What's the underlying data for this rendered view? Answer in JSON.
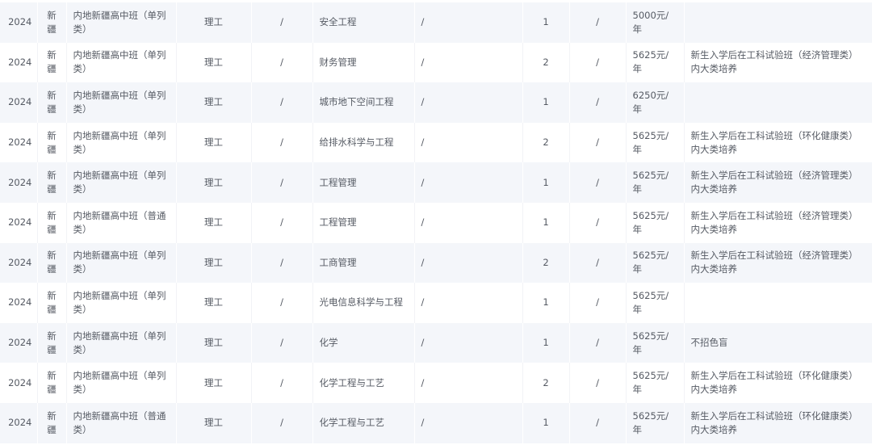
{
  "table": {
    "rows": [
      {
        "year": "2024",
        "region": "新疆",
        "batch": "内地新疆高中班（单列类）",
        "subject": "理工",
        "x1": "/",
        "major": "安全工程",
        "x2": "/",
        "count": "1",
        "x3": "/",
        "fee": "5000元/年",
        "note": ""
      },
      {
        "year": "2024",
        "region": "新疆",
        "batch": "内地新疆高中班（单列类）",
        "subject": "理工",
        "x1": "/",
        "major": "财务管理",
        "x2": "/",
        "count": "2",
        "x3": "/",
        "fee": "5625元/年",
        "note": "新生入学后在工科试验班（经济管理类）内大类培养"
      },
      {
        "year": "2024",
        "region": "新疆",
        "batch": "内地新疆高中班（单列类）",
        "subject": "理工",
        "x1": "/",
        "major": "城市地下空间工程",
        "x2": "/",
        "count": "1",
        "x3": "/",
        "fee": "6250元/年",
        "note": ""
      },
      {
        "year": "2024",
        "region": "新疆",
        "batch": "内地新疆高中班（单列类）",
        "subject": "理工",
        "x1": "/",
        "major": "给排水科学与工程",
        "x2": "/",
        "count": "2",
        "x3": "/",
        "fee": "5625元/年",
        "note": "新生入学后在工科试验班（环化健康类）内大类培养"
      },
      {
        "year": "2024",
        "region": "新疆",
        "batch": "内地新疆高中班（单列类）",
        "subject": "理工",
        "x1": "/",
        "major": "工程管理",
        "x2": "/",
        "count": "1",
        "x3": "/",
        "fee": "5625元/年",
        "note": "新生入学后在工科试验班（经济管理类）内大类培养"
      },
      {
        "year": "2024",
        "region": "新疆",
        "batch": "内地新疆高中班（普通类）",
        "subject": "理工",
        "x1": "/",
        "major": "工程管理",
        "x2": "/",
        "count": "1",
        "x3": "/",
        "fee": "5625元/年",
        "note": "新生入学后在工科试验班（经济管理类）内大类培养"
      },
      {
        "year": "2024",
        "region": "新疆",
        "batch": "内地新疆高中班（单列类）",
        "subject": "理工",
        "x1": "/",
        "major": "工商管理",
        "x2": "/",
        "count": "2",
        "x3": "/",
        "fee": "5625元/年",
        "note": "新生入学后在工科试验班（经济管理类）内大类培养"
      },
      {
        "year": "2024",
        "region": "新疆",
        "batch": "内地新疆高中班（单列类）",
        "subject": "理工",
        "x1": "/",
        "major": "光电信息科学与工程",
        "x2": "/",
        "count": "1",
        "x3": "/",
        "fee": "5625元/年",
        "note": ""
      },
      {
        "year": "2024",
        "region": "新疆",
        "batch": "内地新疆高中班（单列类）",
        "subject": "理工",
        "x1": "/",
        "major": "化学",
        "x2": "/",
        "count": "1",
        "x3": "/",
        "fee": "5625元/年",
        "note": "不招色盲"
      },
      {
        "year": "2024",
        "region": "新疆",
        "batch": "内地新疆高中班（单列类）",
        "subject": "理工",
        "x1": "/",
        "major": "化学工程与工艺",
        "x2": "/",
        "count": "2",
        "x3": "/",
        "fee": "5625元/年",
        "note": "新生入学后在工科试验班（环化健康类）内大类培养"
      },
      {
        "year": "2024",
        "region": "新疆",
        "batch": "内地新疆高中班（普通类）",
        "subject": "理工",
        "x1": "/",
        "major": "化学工程与工艺",
        "x2": "/",
        "count": "1",
        "x3": "/",
        "fee": "5625元/年",
        "note": "新生入学后在工科试验班（环化健康类）内大类培养"
      }
    ]
  }
}
